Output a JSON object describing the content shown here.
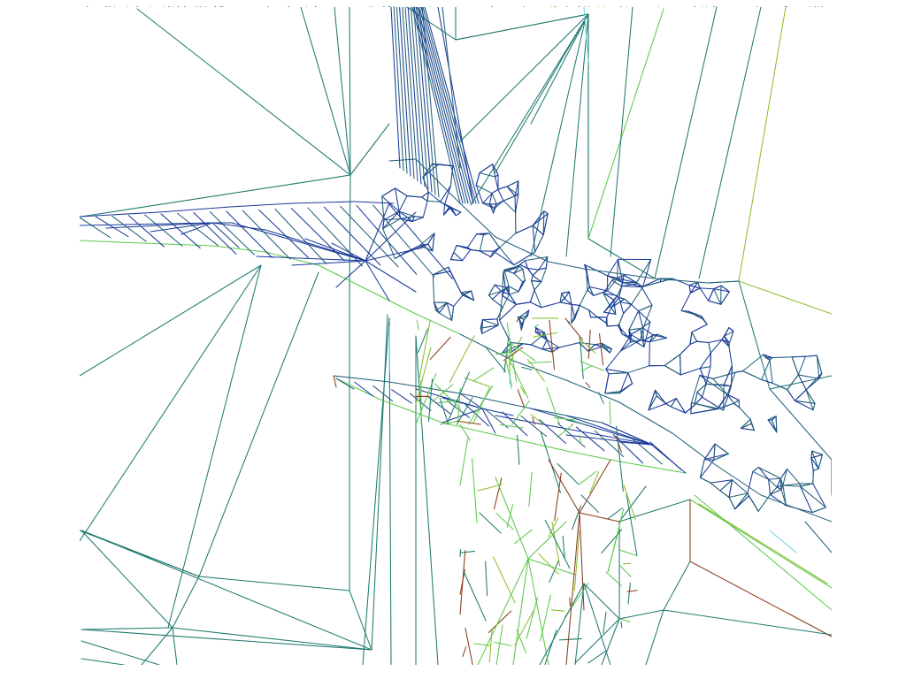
{
  "view": {
    "kind": "wireframe-terrain-mesh",
    "background_color": "#ffffff",
    "edge_palette": {
      "deep": "#1a3a9a",
      "mid": "#23607a",
      "teal": "#1f7a6e",
      "light_green": "#5cc94a",
      "yellow_green": "#8abf2e",
      "brown": "#8a3a1a",
      "cyan": "#6fd6e0"
    }
  }
}
